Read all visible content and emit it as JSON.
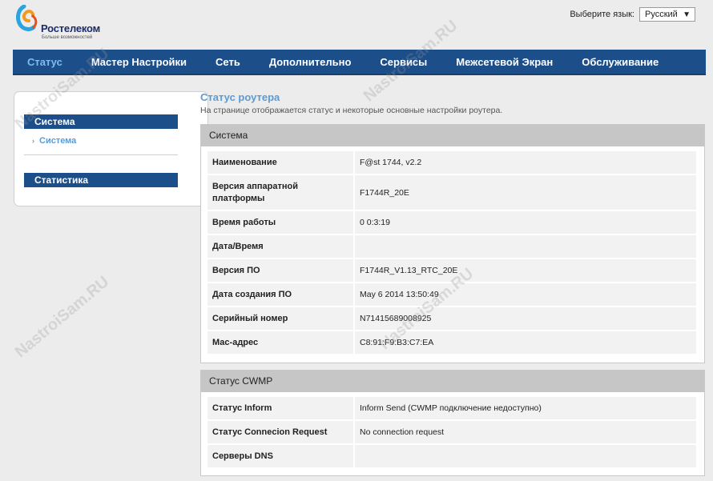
{
  "logo": {
    "name": "Ростелеком",
    "slogan": "Больше возможностей"
  },
  "language": {
    "label": "Выберите язык:",
    "selected": "Русский"
  },
  "nav": {
    "items": [
      {
        "label": "Статус",
        "active": true
      },
      {
        "label": "Мастер Настройки"
      },
      {
        "label": "Сеть"
      },
      {
        "label": "Дополнительно"
      },
      {
        "label": "Сервисы"
      },
      {
        "label": "Межсетевой Экран"
      },
      {
        "label": "Обслуживание"
      }
    ]
  },
  "sidebar": {
    "section1": "Система",
    "link1": "Система",
    "section2": "Статистика"
  },
  "page": {
    "title": "Статус роутера",
    "description": "На странице отображается статус и некоторые основные настройки роутера."
  },
  "system": {
    "title": "Система",
    "rows": [
      {
        "k": "Наименование",
        "v": "F@st 1744, v2.2"
      },
      {
        "k": "Версия аппаратной платформы",
        "v": "F1744R_20E"
      },
      {
        "k": "Время работы",
        "v": "0 0:3:19"
      },
      {
        "k": "Дата/Время",
        "v": ""
      },
      {
        "k": "Версия ПО",
        "v": "F1744R_V1.13_RTC_20E"
      },
      {
        "k": "Дата создания ПО",
        "v": "May 6 2014 13:50:49"
      },
      {
        "k": "Серийный номер",
        "v": "N71415689008925"
      },
      {
        "k": "Мас-адрес",
        "v": "C8:91:F9:B3:C7:EA"
      }
    ]
  },
  "cwmp": {
    "title": "Статус CWMP",
    "rows": [
      {
        "k": "Статус Inform",
        "v": "Inform Send (CWMP подключение недоступно)"
      },
      {
        "k": "Статус Connecion Request",
        "v": "No connection request"
      },
      {
        "k": "Серверы DNS",
        "v": ""
      }
    ]
  },
  "watermark": "NastroiSam.RU",
  "colors": {
    "nav": "#1c4e8a",
    "accent": "#5b9bd5",
    "brand_orange": "#f39a1e"
  }
}
